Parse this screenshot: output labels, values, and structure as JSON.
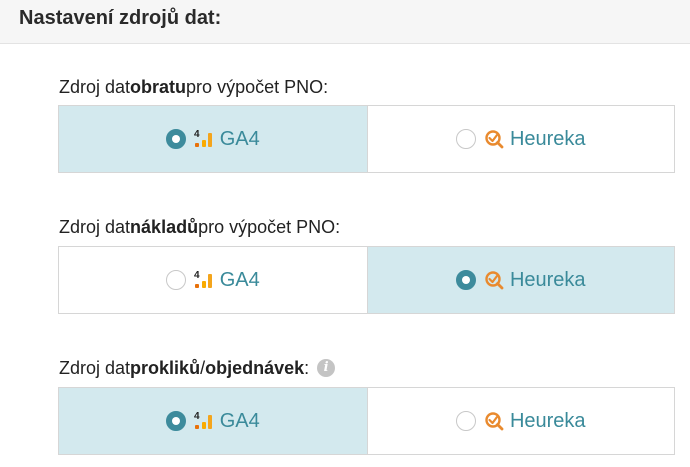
{
  "header": {
    "title": "Nastavení zdrojů dat:"
  },
  "sections": [
    {
      "label_prefix": "Zdroj dat ",
      "label_bold": "obratu",
      "label_suffix": " pro výpočet PNO:",
      "options": [
        {
          "label": "GA4",
          "icon": "ga4-icon",
          "selected": true
        },
        {
          "label": "Heureka",
          "icon": "heureka-icon",
          "selected": false
        }
      ]
    },
    {
      "label_prefix": "Zdroj dat ",
      "label_bold": "nákladů",
      "label_suffix": " pro výpočet PNO:",
      "options": [
        {
          "label": "GA4",
          "icon": "ga4-icon",
          "selected": false
        },
        {
          "label": "Heureka",
          "icon": "heureka-icon",
          "selected": true
        }
      ]
    },
    {
      "label_prefix": "Zdroj dat ",
      "label_bold": "prokliků",
      "label_mid": " / ",
      "label_bold2": "objednávek",
      "label_suffix": ":",
      "info_icon": "info-icon",
      "info_glyph": "i",
      "options": [
        {
          "label": "GA4",
          "icon": "ga4-icon",
          "selected": true
        },
        {
          "label": "Heureka",
          "icon": "heureka-icon",
          "selected": false
        }
      ]
    }
  ],
  "colors": {
    "accent": "#3d8b9c",
    "selected_bg": "#d3e9ee",
    "ga4_orange": "#f4a51c",
    "heureka_orange": "#e98a2e"
  }
}
